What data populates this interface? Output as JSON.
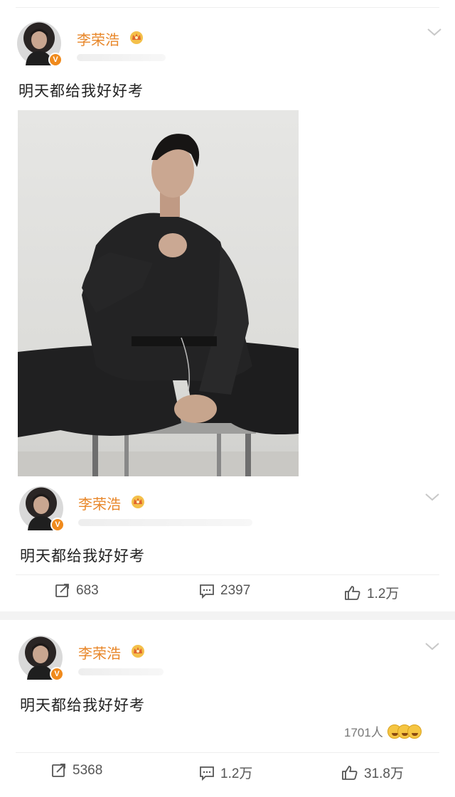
{
  "posts": [
    {
      "username": "李荣浩",
      "verified_badge": "V",
      "text": "明天都给我好好考",
      "has_photo": true
    },
    {
      "username": "李荣浩",
      "verified_badge": "V",
      "text": "明天都给我好好考",
      "actions": {
        "repost": "683",
        "comment": "2397",
        "like": "1.2万"
      }
    },
    {
      "username": "李荣浩",
      "verified_badge": "V",
      "text": "明天都给我好好考",
      "reactions_count": "1701人",
      "actions": {
        "repost": "5368",
        "comment": "1.2万",
        "like": "31.8万"
      }
    }
  ],
  "icons": {
    "verified": "verified-v-icon",
    "crown": "crown-badge-icon",
    "menu": "chevron-down-icon",
    "repost": "repost-icon",
    "comment": "comment-icon",
    "like": "thumbs-up-icon",
    "reactions": "emoji-reactions-icon"
  },
  "colors": {
    "username": "#e8872a",
    "verified": "#f08a1c",
    "text": "#222222",
    "meta": "#555555"
  }
}
